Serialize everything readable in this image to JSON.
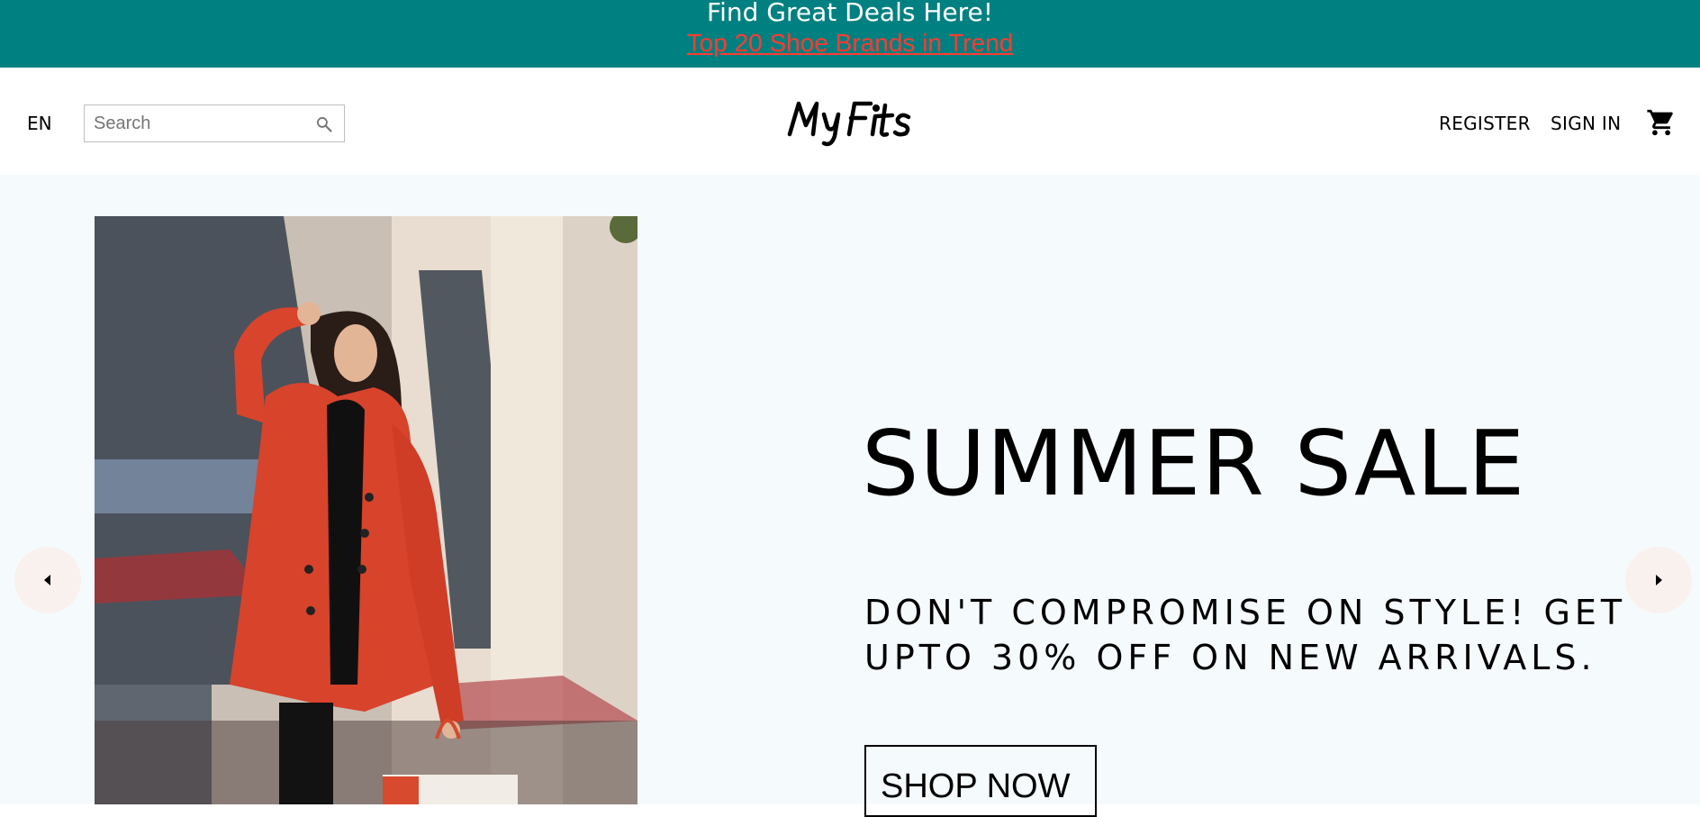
{
  "announcement": {
    "title": "Find Great Deals Here!",
    "link": "Top 20 Shoe Brands in Trend"
  },
  "navbar": {
    "language": "EN",
    "search_placeholder": "Search",
    "search_icon": "magnifier",
    "logo": "MyFits",
    "register": "REGISTER",
    "sign_in": "SIGN IN",
    "cart_icon": "shopping-cart"
  },
  "hero": {
    "title": "SUMMER SALE",
    "description": "DON'T COMPROMISE ON STYLE! GET UPTO 30% OFF ON NEW ARRIVALS.",
    "button": "SHOP NOW",
    "prev_icon": "arrow-left",
    "next_icon": "arrow-right"
  },
  "colors": {
    "announcement_bg": "#008080",
    "announcement_link": "#ff3b30",
    "hero_bg": "#f5fafd",
    "arrow_bg": "#f8f1ee"
  }
}
